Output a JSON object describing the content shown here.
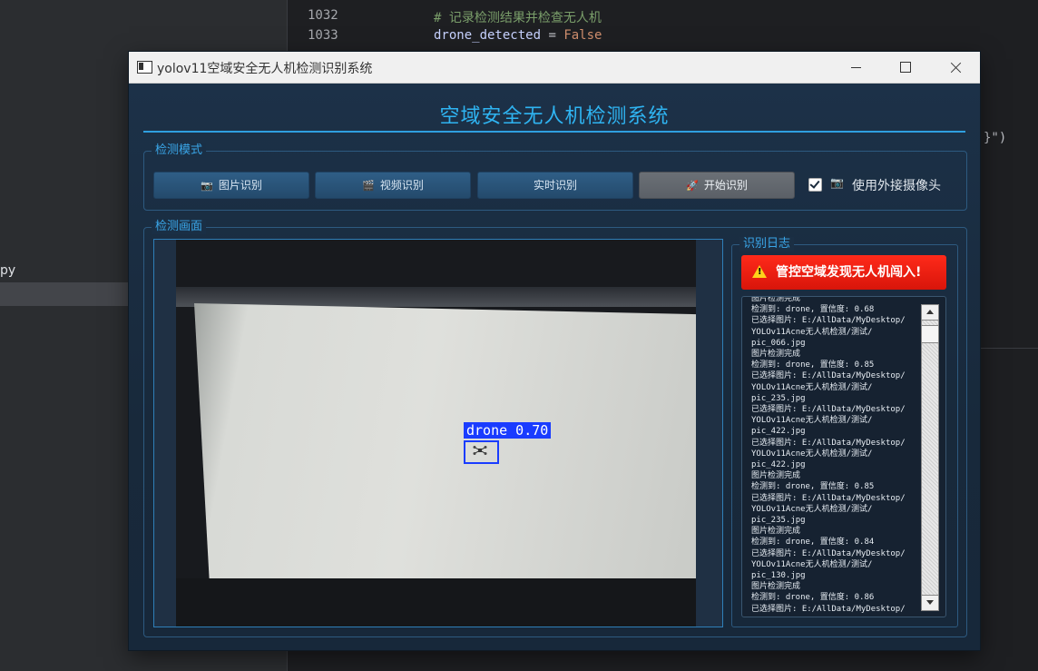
{
  "ide": {
    "line_numbers": [
      "1032",
      "1033"
    ],
    "code_lines": [
      {
        "text": "# 记录检测结果并检查无人机"
      },
      {
        "ident": "drone_detected",
        "op": " = ",
        "kw": "False"
      }
    ],
    "brace_text": "}\")",
    "sidebar_file_text": "py"
  },
  "window": {
    "title": "yolov11空域安全无人机检测识别系统",
    "controls": [
      "minimize",
      "maximize",
      "close"
    ]
  },
  "app": {
    "main_title": "空域安全无人机检测系统",
    "mode_group_label": "检测模式",
    "buttons": {
      "image": {
        "icon": "camera-icon",
        "glyph": "📷",
        "label": "图片识别"
      },
      "video": {
        "icon": "film-icon",
        "glyph": "🎬",
        "label": "视频识别"
      },
      "realtime": {
        "label": "实时识别"
      },
      "start": {
        "icon": "rocket-icon",
        "glyph": "🚀",
        "label": "开始识别"
      }
    },
    "use_external_camera": {
      "checked": true,
      "icon": "camera-icon",
      "glyph": "📷",
      "label": "使用外接摄像头"
    },
    "view_group_label": "检测画面",
    "detection": {
      "label": "drone 0.70",
      "class": "drone",
      "confidence": 0.7,
      "box_color": "#1a3cff"
    },
    "log_group_label": "识别日志",
    "alert": {
      "text": "管控空域发现无人机闯入!",
      "color": "#e01a0c"
    },
    "log_lines": [
      "图片检测完成",
      "检测到: drone, 置信度: 0.68",
      "已选择图片: E:/AllData/MyDesktop/",
      "YOLOv11Acne无人机检测/测试/",
      "pic_066.jpg",
      "图片检测完成",
      "检测到: drone, 置信度: 0.85",
      "已选择图片: E:/AllData/MyDesktop/",
      "YOLOv11Acne无人机检测/测试/",
      "pic_235.jpg",
      "已选择图片: E:/AllData/MyDesktop/",
      "YOLOv11Acne无人机检测/测试/",
      "pic_422.jpg",
      "已选择图片: E:/AllData/MyDesktop/",
      "YOLOv11Acne无人机检测/测试/",
      "pic_422.jpg",
      "图片检测完成",
      "检测到: drone, 置信度: 0.85",
      "已选择图片: E:/AllData/MyDesktop/",
      "YOLOv11Acne无人机检测/测试/",
      "pic_235.jpg",
      "图片检测完成",
      "检测到: drone, 置信度: 0.84",
      "已选择图片: E:/AllData/MyDesktop/",
      "YOLOv11Acne无人机检测/测试/",
      "pic_130.jpg",
      "图片检测完成",
      "检测到: drone, 置信度: 0.86",
      "已选择图片: E:/AllData/MyDesktop/"
    ]
  }
}
